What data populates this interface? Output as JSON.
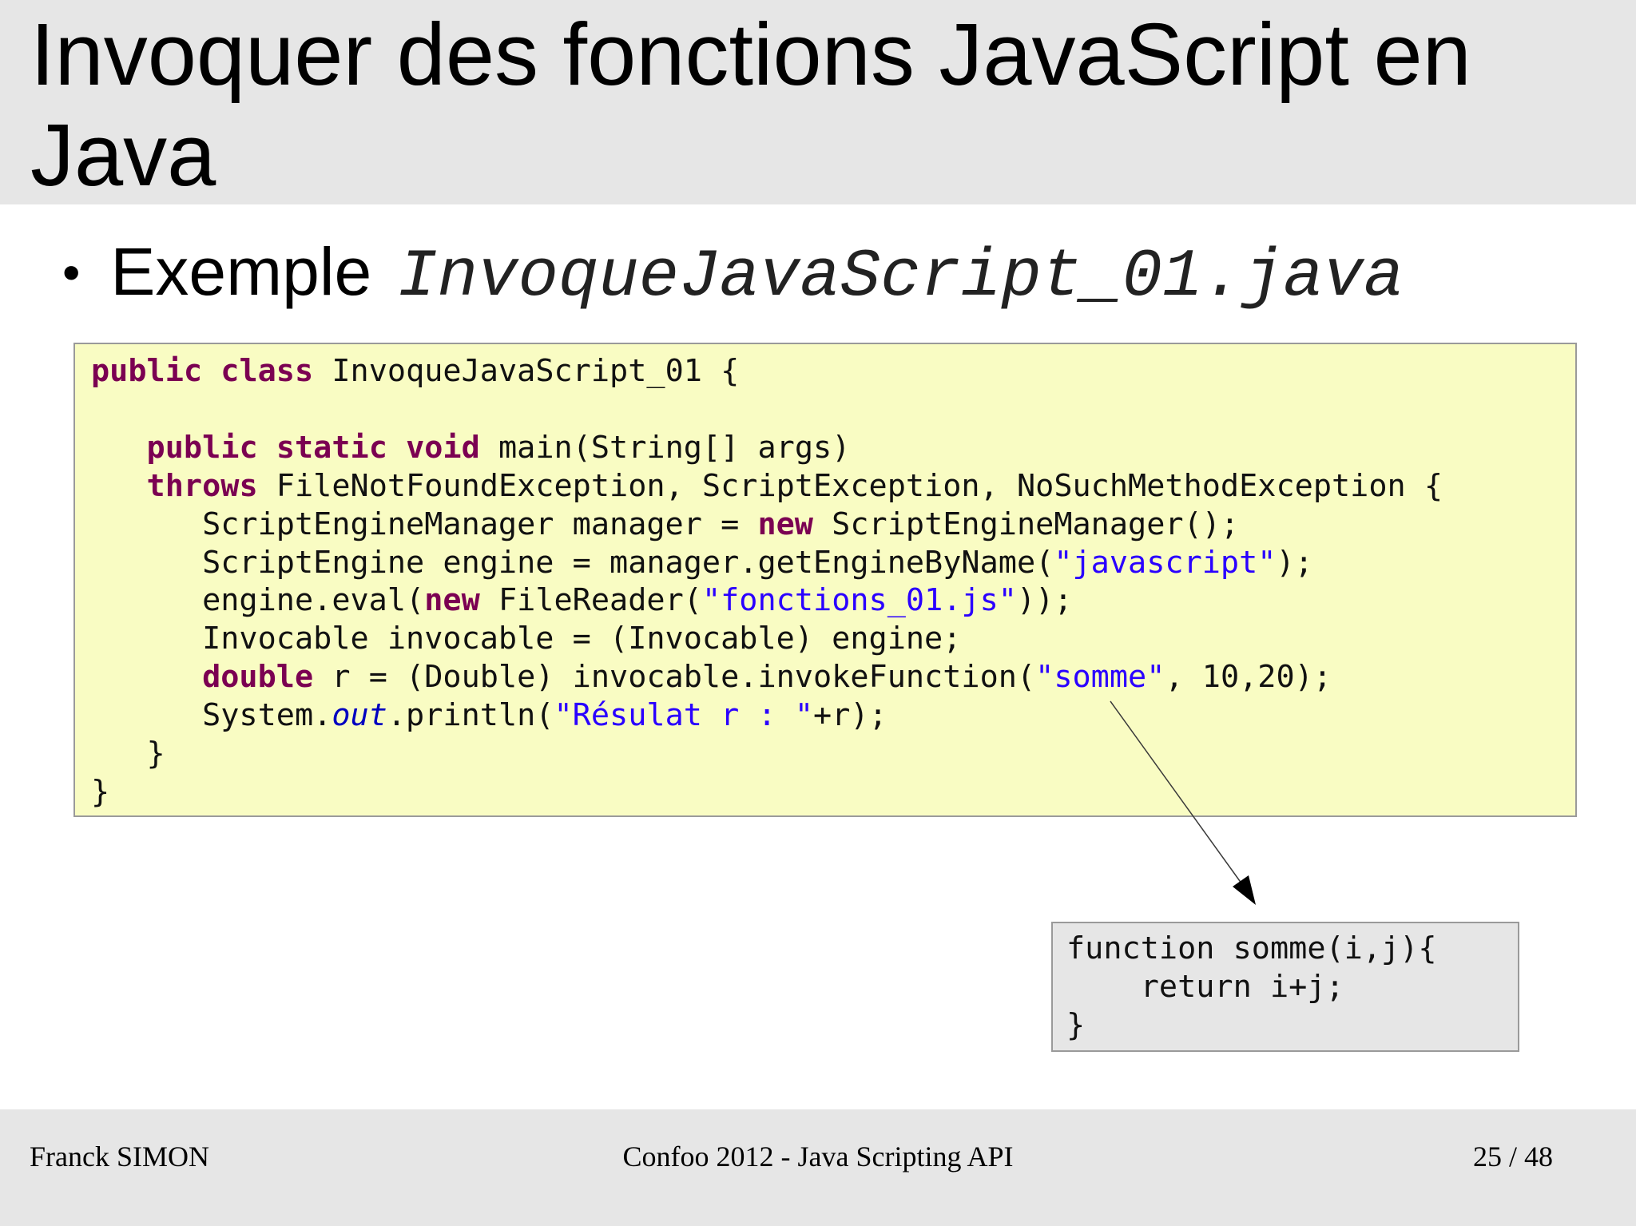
{
  "slide": {
    "title": "Invoquer des fonctions JavaScript en Java",
    "bullet": {
      "symbol": "•",
      "label": "Exemple",
      "filename": "InvoqueJavaScript_01.java"
    }
  },
  "java_code": {
    "line1": {
      "k1": "public",
      "k2": "class",
      "rest": " InvoqueJavaScript_01 {"
    },
    "line3": {
      "indent": "   ",
      "k1": "public",
      "k2": "static",
      "k3": "void",
      "rest": " main(String[] args)"
    },
    "line4": {
      "indent": "   ",
      "k1": "throws",
      "rest": " FileNotFoundException, ScriptException, NoSuchMethodException {"
    },
    "line5": {
      "pre": "      ScriptEngineManager manager = ",
      "k1": "new",
      "rest": " ScriptEngineManager();"
    },
    "line6": {
      "pre": "      ScriptEngine engine = manager.getEngineByName(",
      "s1": "\"javascript\"",
      "rest": ");"
    },
    "line7": {
      "pre": "      engine.eval(",
      "k1": "new",
      "mid": " FileReader(",
      "s1": "\"fonctions_01.js\"",
      "rest": "));"
    },
    "line8": {
      "text": "      Invocable invocable = (Invocable) engine;"
    },
    "line9": {
      "indent": "      ",
      "k1": "double",
      "mid": " r = (Double) invocable.invokeFunction(",
      "s1": "\"somme\"",
      "rest": ", 10,20);"
    },
    "line10": {
      "pre": "      System.",
      "f1": "out",
      "mid": ".println(",
      "s1": "\"Résulat r : \"",
      "rest": "+r);"
    },
    "line11": {
      "text": "   }"
    },
    "line12": {
      "text": "}"
    }
  },
  "js_code": {
    "line1": "function somme(i,j){",
    "line2": "    return i+j;",
    "line3": "}"
  },
  "footer": {
    "author": "Franck SIMON",
    "event": "Confoo 2012 - Java Scripting API",
    "page": "25 / 48"
  }
}
